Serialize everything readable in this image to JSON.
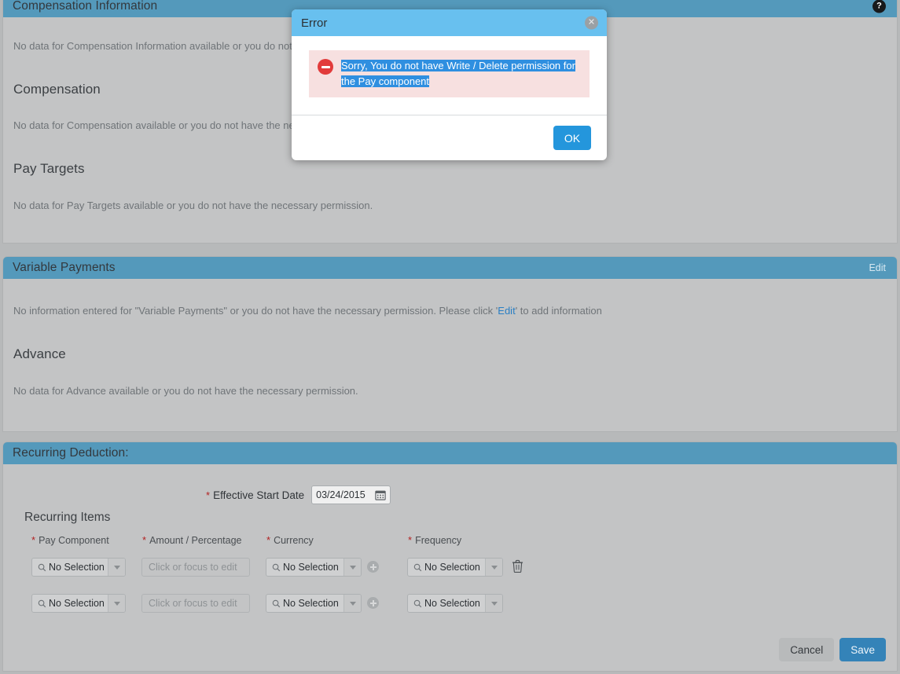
{
  "panels": {
    "compensation": {
      "title": "Compensation Information",
      "help_icon": "help-circle-icon",
      "note_1": "No data for Compensation Information available or you do not have the necessary permission.",
      "sub_head_2": "Compensation",
      "note_2": "No data for Compensation available or you do not have the necessary permission.",
      "sub_head_3": "Pay Targets",
      "note_3": "No data for Pay Targets available or you do not have the necessary permission."
    },
    "variable_payments": {
      "title": "Variable Payments",
      "edit_label": "Edit",
      "note_1_before": "No information entered for \"Variable Payments\" or you do not have the necessary permission. Please click '",
      "note_1_link": "Edit",
      "note_1_after": "' to add information",
      "sub_head_2": "Advance",
      "note_2": "No data for Advance available or you do not have the necessary permission."
    },
    "recurring_deduction": {
      "title": "Recurring Deduction:",
      "effective_start_date_label": "Effective Start Date",
      "effective_start_date_value": "03/24/2015",
      "calendar_icon": "calendar-icon",
      "items_title": "Recurring Items",
      "columns": [
        {
          "label": "Pay Component",
          "required": true
        },
        {
          "label": "Amount / Percentage",
          "required": true
        },
        {
          "label": "Currency",
          "required": true
        },
        {
          "label": "Frequency",
          "required": true
        }
      ],
      "rows": [
        {
          "pay_component": "No Selection",
          "amount_placeholder": "Click or focus to edit",
          "amount_value": "",
          "currency": "No Selection",
          "frequency": "No Selection",
          "has_delete": true
        },
        {
          "pay_component": "No Selection",
          "amount_placeholder": "Click or focus to edit",
          "amount_value": "",
          "currency": "No Selection",
          "frequency": "No Selection",
          "has_delete": false
        }
      ]
    }
  },
  "footer": {
    "cancel_label": "Cancel",
    "save_label": "Save"
  },
  "dialog": {
    "title": "Error",
    "close_icon": "close-icon",
    "error_icon": "no-entry-icon",
    "message_line_1": "Sorry, You do not have Write / Delete permission for",
    "message_line_2": "the Pay component",
    "ok_label": "OK"
  },
  "colors": {
    "panel_header": "#5499bb",
    "dialog_header": "#68c0ef",
    "page_background": "#b7b9ba",
    "panel_background": "#c3c4c5",
    "save_button": "#3483b8",
    "ok_button": "#2496dc",
    "error_red": "#e23b3b",
    "error_background": "#f7e0e0",
    "selection_blue": "#2f8fe0",
    "link_blue": "#2a7fc4",
    "required_star": "#b22222"
  }
}
